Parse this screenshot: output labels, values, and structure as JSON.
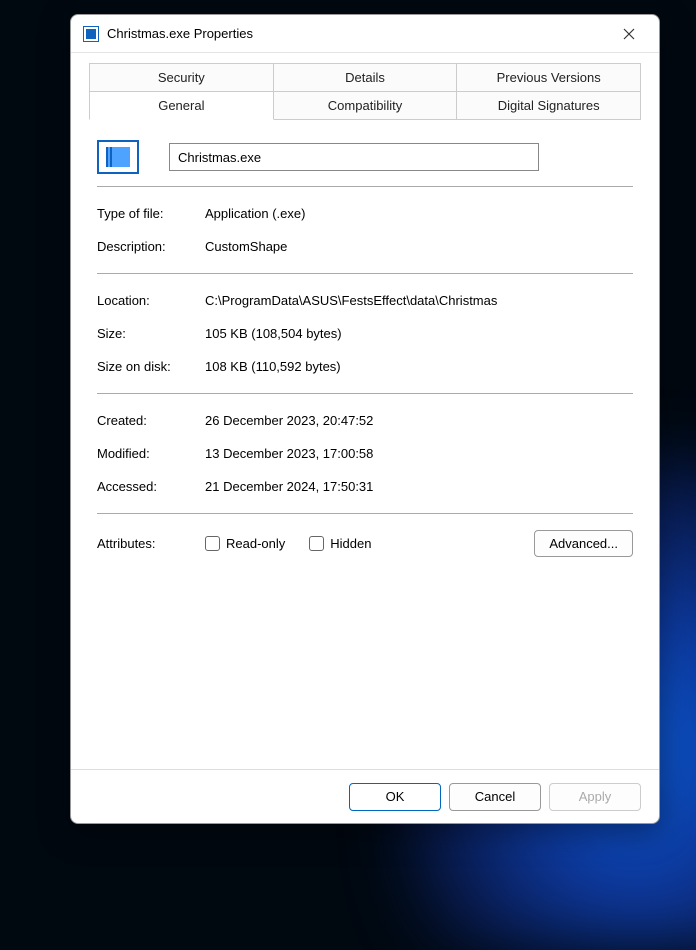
{
  "titlebar": {
    "title": "Christmas.exe Properties"
  },
  "tabs": {
    "row1": [
      "Security",
      "Details",
      "Previous Versions"
    ],
    "row2": [
      "General",
      "Compatibility",
      "Digital Signatures"
    ],
    "active": "General"
  },
  "general": {
    "filename": "Christmas.exe",
    "type_label": "Type of file:",
    "type_value": "Application (.exe)",
    "desc_label": "Description:",
    "desc_value": "CustomShape",
    "location_label": "Location:",
    "location_value": "C:\\ProgramData\\ASUS\\FestsEffect\\data\\Christmas",
    "size_label": "Size:",
    "size_value": "105 KB (108,504 bytes)",
    "size_on_disk_label": "Size on disk:",
    "size_on_disk_value": "108 KB (110,592 bytes)",
    "created_label": "Created:",
    "created_value": "26 December 2023, 20:47:52",
    "modified_label": "Modified:",
    "modified_value": "13 December 2023, 17:00:58",
    "accessed_label": "Accessed:",
    "accessed_value": "21 December 2024, 17:50:31",
    "attributes_label": "Attributes:",
    "readonly_label": "Read-only",
    "hidden_label": "Hidden",
    "advanced_label": "Advanced..."
  },
  "footer": {
    "ok": "OK",
    "cancel": "Cancel",
    "apply": "Apply"
  }
}
